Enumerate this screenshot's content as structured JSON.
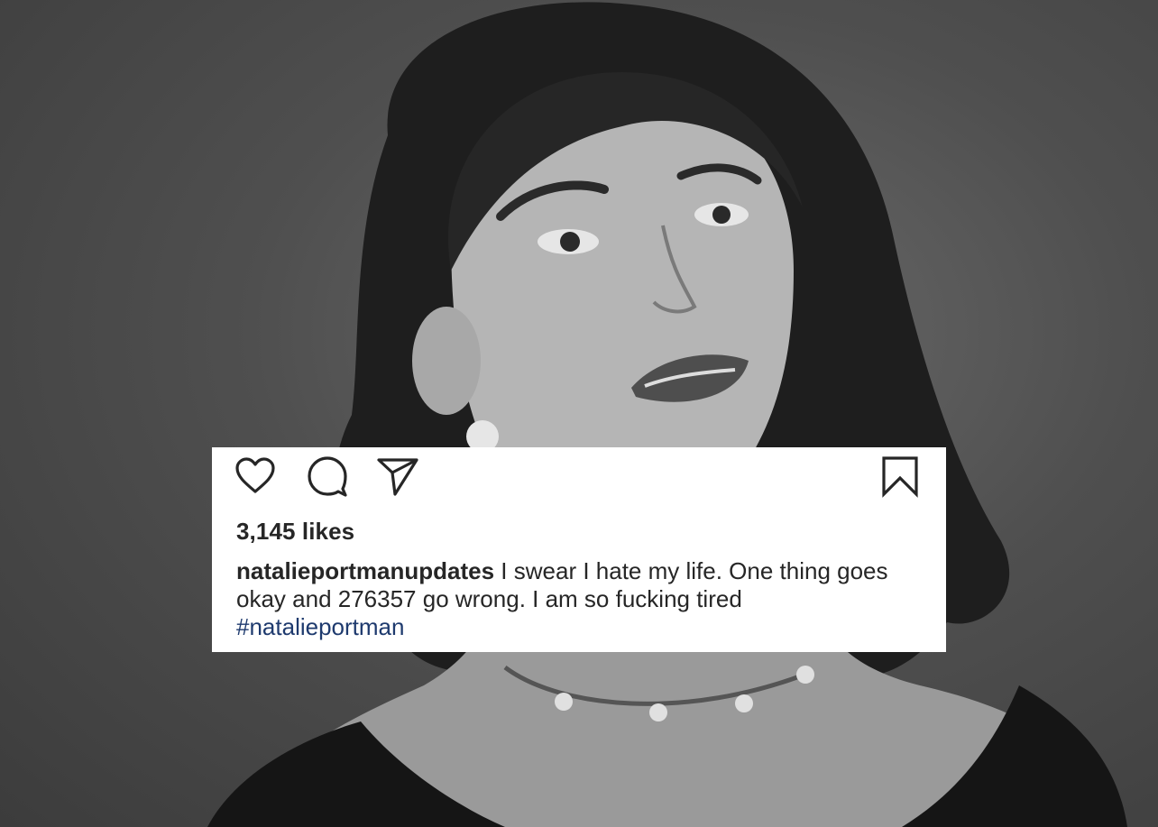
{
  "post": {
    "likes": "3,145 likes",
    "username": "natalieportmanupdates",
    "caption_text": "I swear I hate my life. One thing goes okay and 276357 go wrong. I am so fucking tired",
    "hashtag": "#natalieportman"
  },
  "actions": {
    "like_icon": "heart-icon",
    "comment_icon": "comment-icon",
    "share_icon": "paper-plane-icon",
    "save_icon": "bookmark-icon"
  },
  "colors": {
    "text": "#262626",
    "hashtag": "#1e3a6e",
    "card_background": "#ffffff"
  }
}
